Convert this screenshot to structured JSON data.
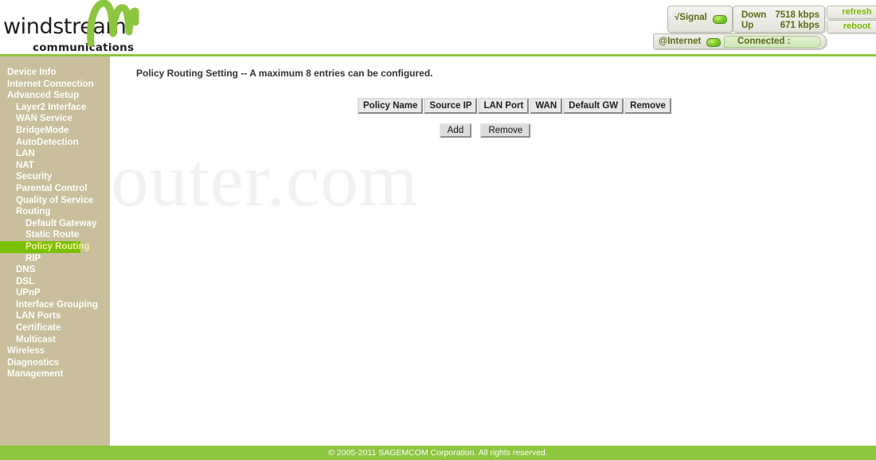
{
  "header": {
    "logo": {
      "wordmark": "windstream",
      "trademark": "™",
      "subtitle": "communications",
      "wave_icon": "windstream-wave-logo"
    },
    "status": {
      "signal_label": "√Signal",
      "signal_led": "green-led",
      "down_label": "Down",
      "down_value": "7518 kbps",
      "up_label": "Up",
      "up_value": "671 kbps",
      "internet_label": "@Internet",
      "internet_led": "green-led",
      "connection_status": "Connected :"
    },
    "buttons": {
      "refresh": "refresh",
      "reboot": "reboot"
    }
  },
  "sidebar": {
    "items": [
      {
        "label": "Device Info",
        "level": 1,
        "active": false
      },
      {
        "label": "Internet Connection",
        "level": 1,
        "active": false
      },
      {
        "label": "Advanced Setup",
        "level": 1,
        "active": false
      },
      {
        "label": "Layer2 Interface",
        "level": 2,
        "active": false
      },
      {
        "label": "WAN Service",
        "level": 2,
        "active": false
      },
      {
        "label": "BridgeMode",
        "level": 2,
        "active": false
      },
      {
        "label": "AutoDetection",
        "level": 2,
        "active": false
      },
      {
        "label": "LAN",
        "level": 2,
        "active": false
      },
      {
        "label": "NAT",
        "level": 2,
        "active": false
      },
      {
        "label": "Security",
        "level": 2,
        "active": false
      },
      {
        "label": "Parental Control",
        "level": 2,
        "active": false
      },
      {
        "label": "Quality of Service",
        "level": 2,
        "active": false
      },
      {
        "label": "Routing",
        "level": 2,
        "active": false
      },
      {
        "label": "Default Gateway",
        "level": 3,
        "active": false
      },
      {
        "label": "Static Route",
        "level": 3,
        "active": false
      },
      {
        "label": "Policy Routing",
        "level": 3,
        "active": true
      },
      {
        "label": "RIP",
        "level": 3,
        "active": false
      },
      {
        "label": "DNS",
        "level": 2,
        "active": false
      },
      {
        "label": "DSL",
        "level": 2,
        "active": false
      },
      {
        "label": "UPnP",
        "level": 2,
        "active": false
      },
      {
        "label": "Interface Grouping",
        "level": 2,
        "active": false
      },
      {
        "label": "LAN Ports",
        "level": 2,
        "active": false
      },
      {
        "label": "Certificate",
        "level": 2,
        "active": false
      },
      {
        "label": "Multicast",
        "level": 2,
        "active": false
      },
      {
        "label": "Wireless",
        "level": 1,
        "active": false
      },
      {
        "label": "Diagnostics",
        "level": 1,
        "active": false
      },
      {
        "label": "Management",
        "level": 1,
        "active": false
      }
    ]
  },
  "main": {
    "heading": "Policy Routing Setting -- A maximum 8 entries can be configured.",
    "watermark": "upRouter.com",
    "table": {
      "columns": [
        "Policy Name",
        "Source IP",
        "LAN Port",
        "WAN",
        "Default GW",
        "Remove"
      ],
      "rows": []
    },
    "buttons": {
      "add": "Add",
      "remove": "Remove"
    }
  },
  "footer": {
    "copyright": "© 2005-2011 SAGEMCOM Corporation. All rights reserved."
  },
  "colors": {
    "brand_green": "#8dc63f",
    "highlight_green": "#7ac000",
    "sidebar_tan": "#c9bf9c",
    "status_text": "#5d6b17"
  }
}
